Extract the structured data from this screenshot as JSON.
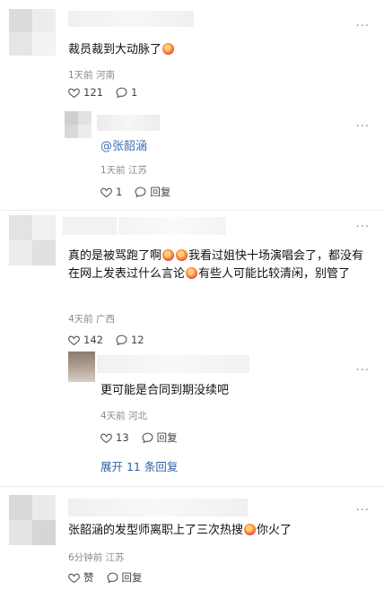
{
  "comments": [
    {
      "text": "裁员裁到大动脉了",
      "meta": "1天前 河南",
      "likes": "121",
      "replies": "1",
      "more": "···",
      "icons": [
        "heart-icon",
        "comment-icon",
        "laugh-cry-emoji"
      ]
    },
    {
      "mention": "@张韶涵",
      "meta": "1天前 江苏",
      "likes": "1",
      "replies": "回复",
      "more": "···",
      "icons": [
        "heart-icon",
        "comment-icon"
      ]
    },
    {
      "text_parts": [
        "真的是被骂跑了啊",
        "我看过姐快十场演唱会了，都没有在网上发表过什么言论",
        "有些人可能比较清闲，别管了"
      ],
      "meta": "4天前 广西",
      "likes": "142",
      "replies": "12",
      "more": "···",
      "icons": [
        "heart-icon",
        "comment-icon",
        "laugh-cry-emoji"
      ]
    },
    {
      "text": "更可能是合同到期没续吧",
      "meta": "4天前 河北",
      "likes": "13",
      "replies": "回复",
      "more": "···",
      "icons": [
        "heart-icon",
        "comment-icon"
      ]
    },
    {
      "expand": "展开 11 条回复"
    },
    {
      "text_parts": [
        "张韶涵的发型师离职上了三次热搜",
        "你火了"
      ],
      "meta": "6分钟前 江苏",
      "likes": "赞",
      "replies": "回复",
      "more": "···",
      "icons": [
        "heart-icon",
        "comment-icon",
        "laugh-cry-emoji"
      ]
    }
  ]
}
